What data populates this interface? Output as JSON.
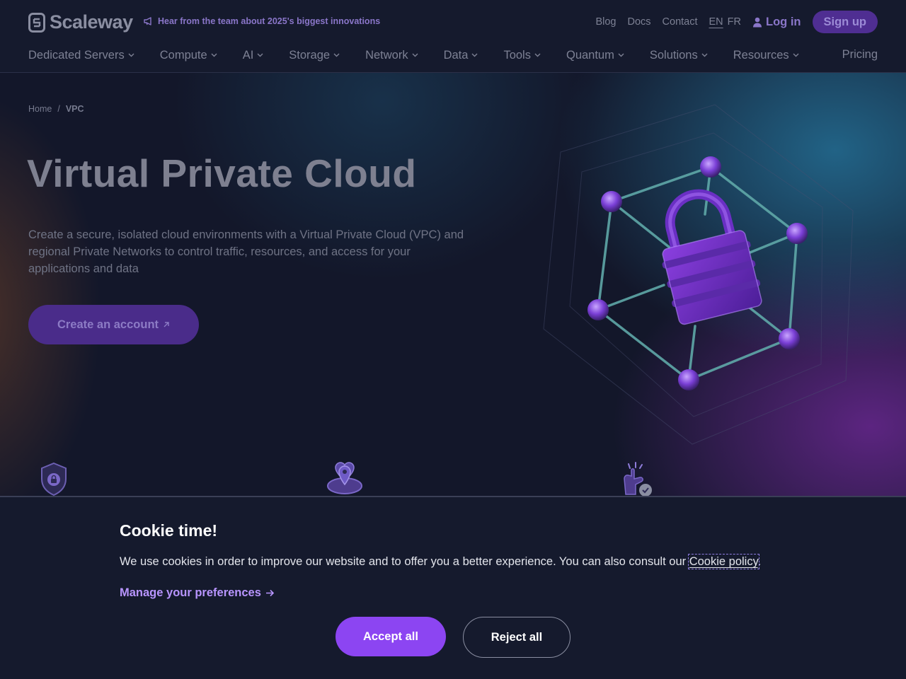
{
  "header": {
    "logo_text": "Scaleway",
    "announcement": "Hear from the team about 2025's biggest innovations",
    "top_links": [
      "Blog",
      "Docs",
      "Contact"
    ],
    "languages": [
      "EN",
      "FR"
    ],
    "active_language": "EN",
    "login_label": "Log in",
    "signup_label": "Sign up"
  },
  "nav": {
    "items": [
      "Dedicated Servers",
      "Compute",
      "AI",
      "Storage",
      "Network",
      "Data",
      "Tools",
      "Quantum",
      "Solutions",
      "Resources"
    ],
    "pricing_label": "Pricing"
  },
  "hero": {
    "breadcrumb": [
      "Home",
      "VPC"
    ],
    "breadcrumb_separator": "/",
    "title": "Virtual Private Cloud",
    "description": "Create a secure, isolated cloud environments with a Virtual Private Cloud (VPC) and regional Private Networks to control traffic, resources, and access for your applications and data",
    "cta_label": "Create an account",
    "feature_icons": [
      "shield-lock-icon",
      "map-pins-icon",
      "hand-check-icon"
    ]
  },
  "cookie": {
    "title": "Cookie time!",
    "text": "We use cookies in order to improve our website and to offer you a better experience. You can also consult our ",
    "policy_link": "Cookie policy",
    "text_end": ".",
    "preferences_label": "Manage your preferences",
    "accept_label": "Accept all",
    "reject_label": "Reject all"
  },
  "colors": {
    "accent": "#8c45f2",
    "link_purple": "#b895ff",
    "background": "#151a2d"
  }
}
